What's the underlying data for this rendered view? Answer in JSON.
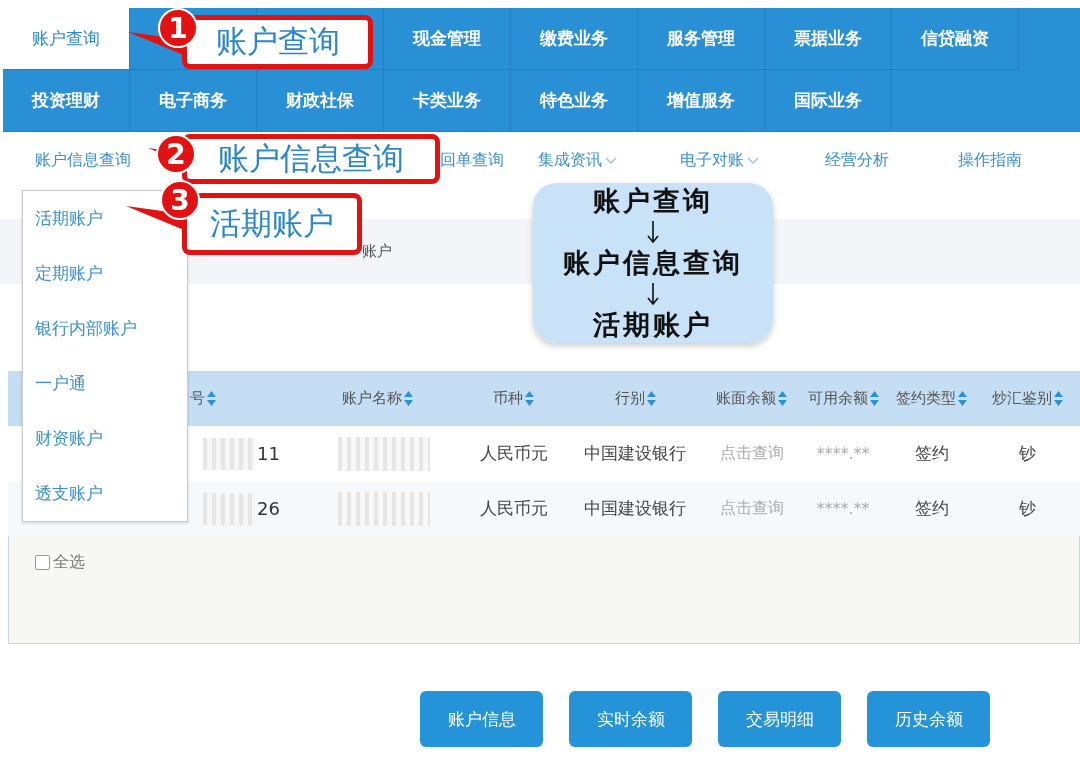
{
  "top_nav": {
    "rows": [
      [
        {
          "label": "账户查询",
          "selected": true
        },
        {},
        {},
        {
          "label": "现金管理",
          "selected": false
        },
        {
          "label": "缴费业务",
          "selected": false
        },
        {
          "label": "服务管理",
          "selected": false
        },
        {
          "label": "票据业务",
          "selected": false
        },
        {
          "label": "信贷融资",
          "selected": false
        }
      ],
      [
        {
          "label": "投资理财",
          "selected": false
        },
        {
          "label": "电子商务",
          "selected": false
        },
        {
          "label": "财政社保",
          "selected": false
        },
        {
          "label": "卡类业务",
          "selected": false
        },
        {
          "label": "特色业务",
          "selected": false
        },
        {
          "label": "增值服务",
          "selected": false
        },
        {
          "label": "国际业务",
          "selected": false
        }
      ]
    ]
  },
  "sub_nav": [
    {
      "label": "账户信息查询",
      "has_dropdown": false
    },
    {
      "label": "回单查询",
      "has_dropdown": false
    },
    {
      "label": "集成资讯",
      "has_dropdown": true
    },
    {
      "label": "电子对账",
      "has_dropdown": true
    },
    {
      "label": "经营分析",
      "has_dropdown": false
    },
    {
      "label": "操作指南",
      "has_dropdown": false
    }
  ],
  "dropdown_menu": [
    "活期账户",
    "定期账户",
    "银行内部账户",
    "一户通",
    "财资账户",
    "透支账户"
  ],
  "breadcrumb": "账户",
  "table": {
    "columns": [
      "号",
      "账户名称",
      "币种",
      "行别",
      "账面余额",
      "可用余额",
      "签约类型",
      "炒汇鉴别"
    ],
    "rows": [
      {
        "account_suffix": "11",
        "currency": "人民币元",
        "bank": "中国建设银行",
        "book_balance": "点击查询",
        "available_balance": "****.**",
        "sign_type": "签约",
        "fx_type": "钞"
      },
      {
        "account_suffix": "26",
        "currency": "人民币元",
        "bank": "中国建设银行",
        "book_balance": "点击查询",
        "available_balance": "****.**",
        "sign_type": "签约",
        "fx_type": "钞"
      }
    ],
    "select_all": {
      "label": "全选",
      "checked": false
    }
  },
  "buttons": [
    "账户信息",
    "实时余额",
    "交易明细",
    "历史余额"
  ],
  "callouts": [
    {
      "number": "1",
      "text": "账户查询"
    },
    {
      "number": "2",
      "text": "账户信息查询"
    },
    {
      "number": "3",
      "text": "活期账户"
    }
  ],
  "flow_note": {
    "steps": [
      "账户查询",
      "账户信息查询",
      "活期账户"
    ]
  }
}
